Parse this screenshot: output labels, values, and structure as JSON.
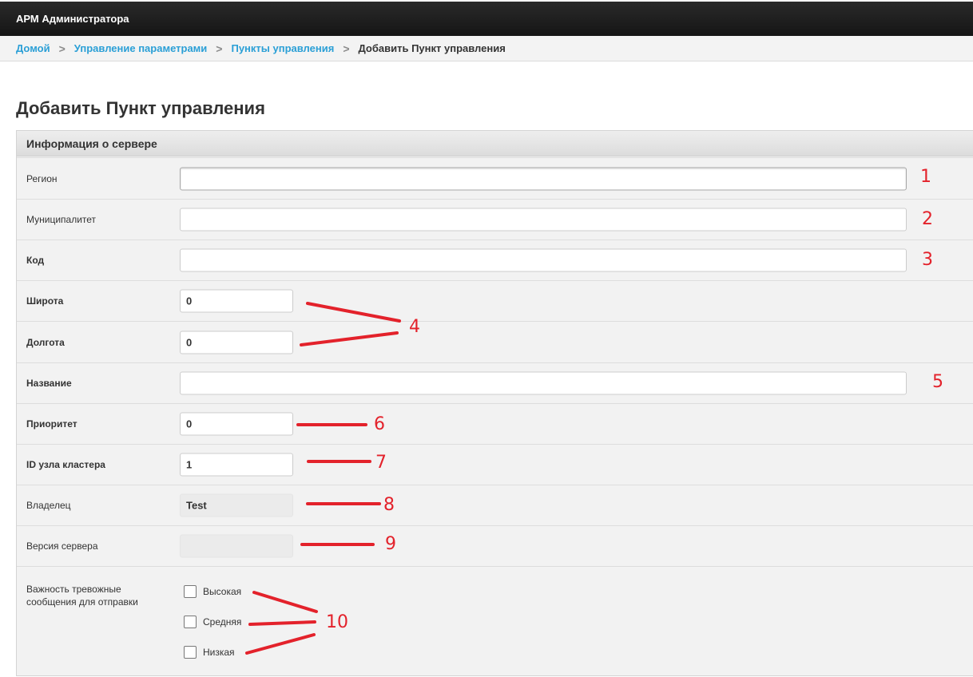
{
  "app": {
    "title": "АРМ Администратора"
  },
  "breadcrumb": {
    "items": [
      "Домой",
      "Управление параметрами",
      "Пункты управления"
    ],
    "current": "Добавить Пункт управления",
    "separator": ">"
  },
  "page": {
    "title": "Добавить Пункт управления"
  },
  "panel": {
    "title": "Информация о сервере",
    "fields": {
      "region": {
        "label": "Регион",
        "value": ""
      },
      "municipality": {
        "label": "Муниципалитет",
        "value": ""
      },
      "code": {
        "label": "Код",
        "value": ""
      },
      "latitude": {
        "label": "Широта",
        "value": "0"
      },
      "longitude": {
        "label": "Долгота",
        "value": "0"
      },
      "name": {
        "label": "Название",
        "value": ""
      },
      "priority": {
        "label": "Приоритет",
        "value": "0"
      },
      "cluster_node_id": {
        "label": "ID узла кластера",
        "value": "1"
      },
      "owner": {
        "label": "Владелец",
        "value": "Test"
      },
      "server_version": {
        "label": "Версия сервера",
        "value": ""
      }
    },
    "severity": {
      "label_line1": "Важность тревожные",
      "label_line2": "сообщения для отправки",
      "options": [
        "Высокая",
        "Средняя",
        "Низкая"
      ],
      "checked": [
        false,
        false,
        false
      ]
    }
  },
  "annotations": {
    "labels": [
      "1",
      "2",
      "3",
      "4",
      "5",
      "6",
      "7",
      "8",
      "9",
      "10"
    ],
    "color": "#e3222b"
  },
  "colors": {
    "topbar": "#1f1f1f",
    "link": "#2a9fd6",
    "panel_bg": "#f2f2f2",
    "annotation": "#e3222b"
  }
}
